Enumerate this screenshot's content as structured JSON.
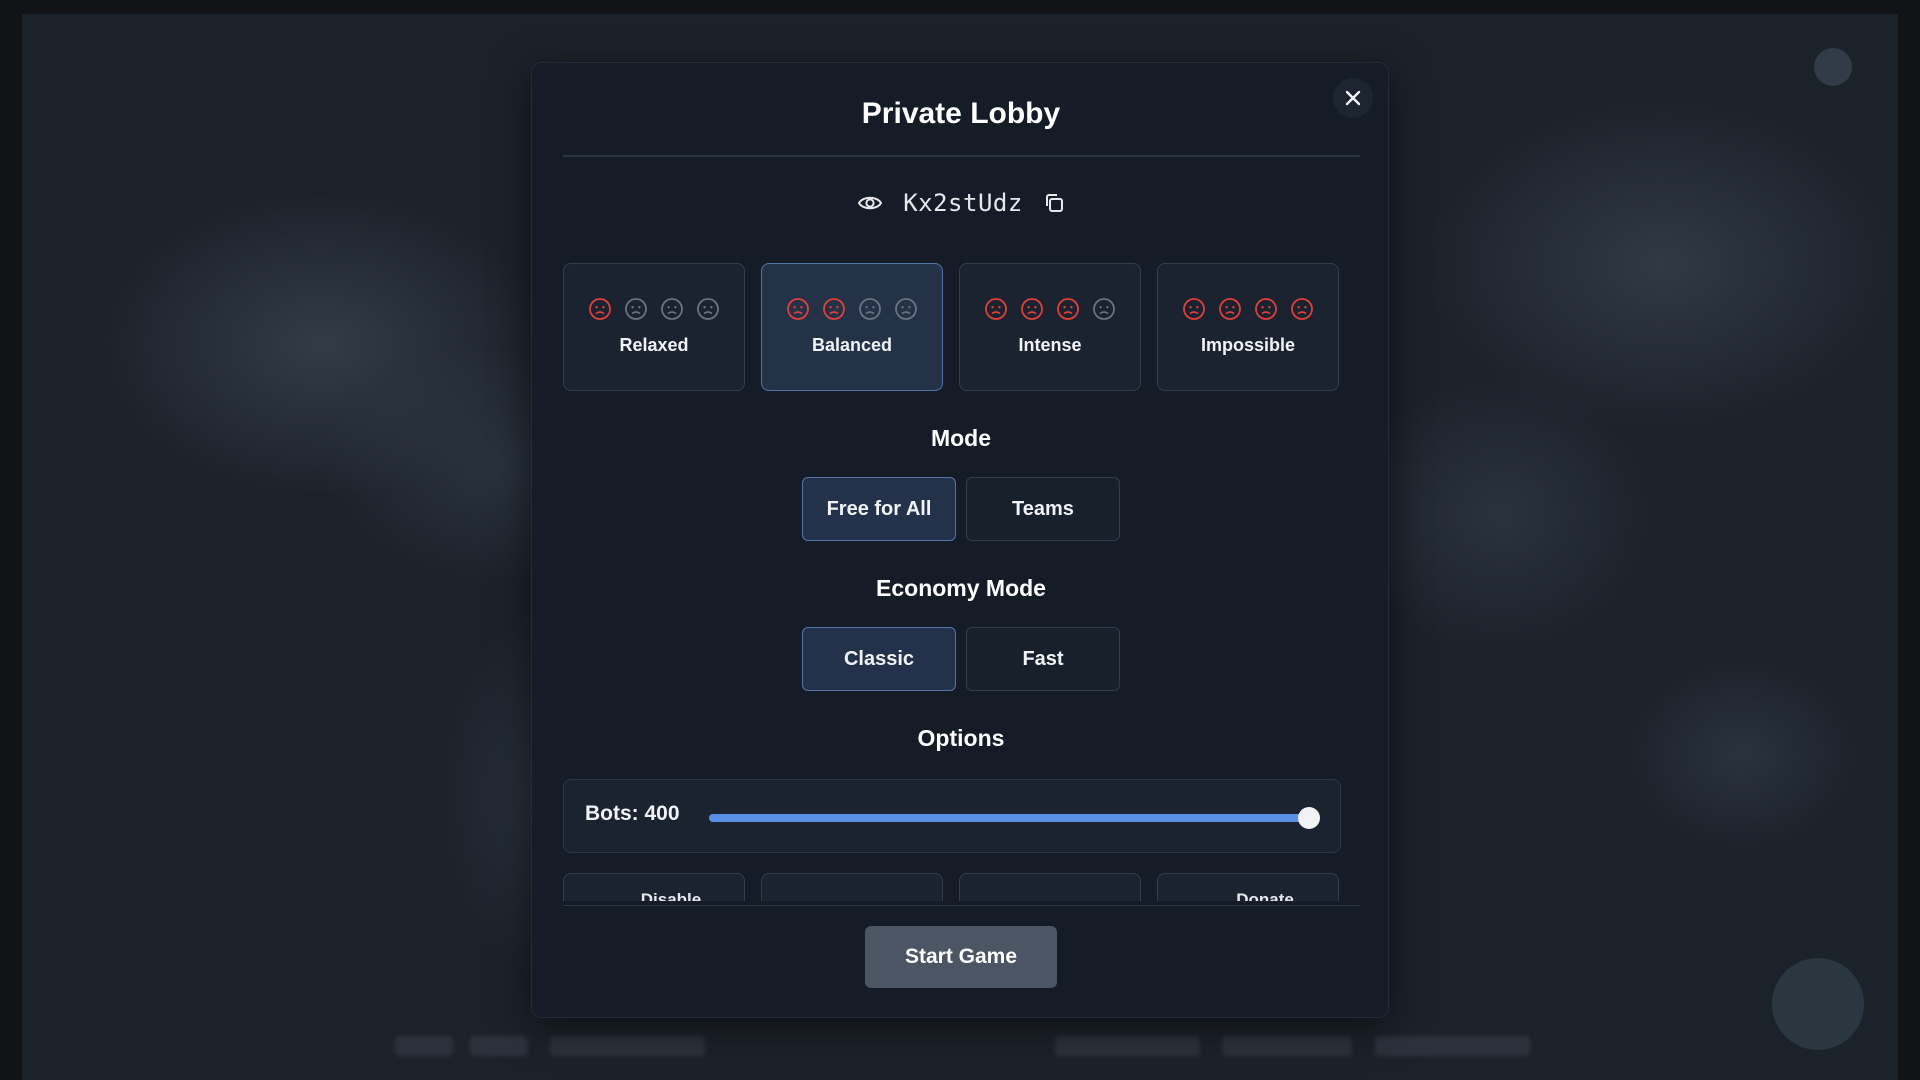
{
  "modal": {
    "title": "Private Lobby",
    "lobby_id": "Kx2stUdz"
  },
  "icons": {
    "close": "close-icon",
    "visibility": "eye-icon",
    "copy": "copy-icon",
    "difficulty_face": "angry-face-icon"
  },
  "colors": {
    "face_active": "#e0403a",
    "face_inactive": "#6b7280",
    "selected_border": "#5474a6",
    "slider_fill": "#5b8fe6",
    "start_button": "#4b5563"
  },
  "difficulties": [
    {
      "label": "Relaxed",
      "level": 1,
      "selected": false
    },
    {
      "label": "Balanced",
      "level": 2,
      "selected": true
    },
    {
      "label": "Intense",
      "level": 3,
      "selected": false
    },
    {
      "label": "Impossible",
      "level": 4,
      "selected": false
    }
  ],
  "mode": {
    "title": "Mode",
    "options": [
      {
        "label": "Free for All",
        "selected": true
      },
      {
        "label": "Teams",
        "selected": false
      }
    ]
  },
  "economy": {
    "title": "Economy Mode",
    "options": [
      {
        "label": "Classic",
        "selected": true
      },
      {
        "label": "Fast",
        "selected": false
      }
    ]
  },
  "options": {
    "title": "Options",
    "bots_label": "Bots: 400",
    "bots_value": 400,
    "bots_max": 400,
    "cards": [
      {
        "label": "Disable"
      },
      {
        "label": ""
      },
      {
        "label": ""
      },
      {
        "label": "Donate"
      }
    ]
  },
  "start_button": "Start Game"
}
